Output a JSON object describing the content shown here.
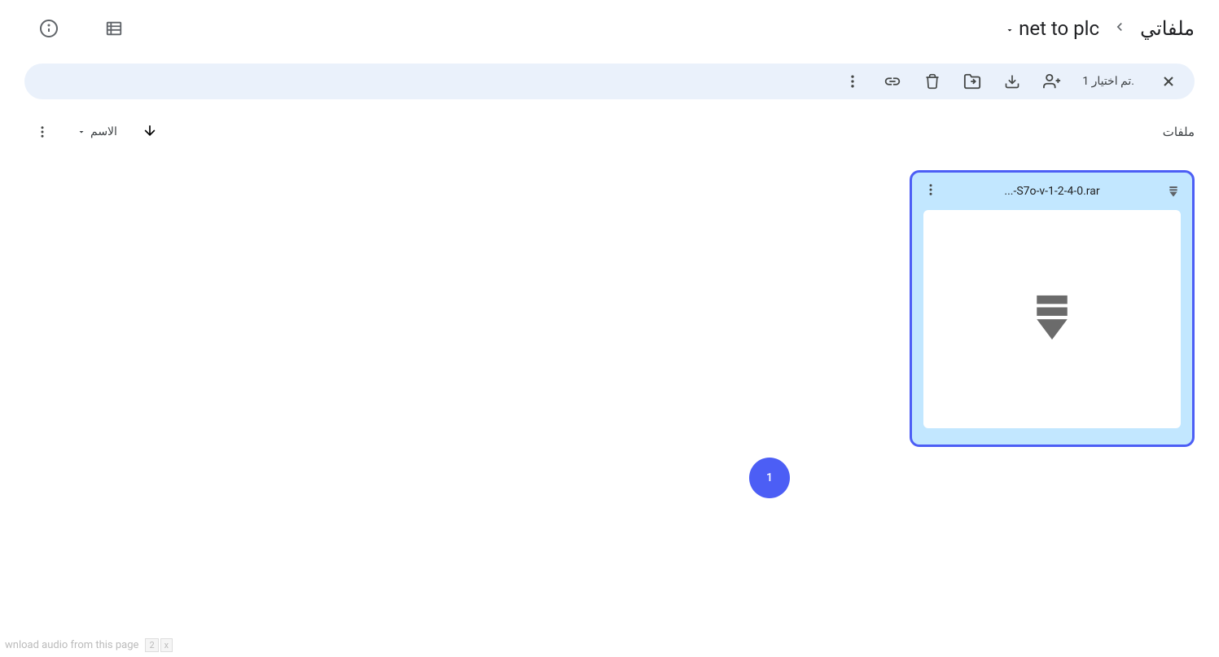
{
  "breadcrumb": {
    "root": "ملفاتي",
    "current": "net to plc"
  },
  "selection": {
    "count_text": "تم اختيار 1."
  },
  "content": {
    "section_label": "ملفات",
    "sort_label": "الاسم"
  },
  "file": {
    "name": "...-S7o-v-1-2-4-0.rar"
  },
  "badge": {
    "count": "1"
  },
  "footer": {
    "text": "wnload audio from this page",
    "btn1": "2",
    "btn2": "x"
  }
}
